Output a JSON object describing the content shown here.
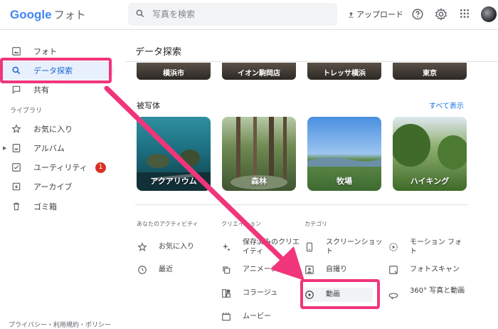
{
  "header": {
    "logo_google": "Google",
    "logo_product": "フォト",
    "search_placeholder": "写真を検索",
    "upload_label": "アップロード"
  },
  "sidebar": {
    "items": [
      {
        "label": "フォト",
        "icon": "photo-icon"
      },
      {
        "label": "データ探索",
        "icon": "search-icon",
        "active": true
      },
      {
        "label": "共有",
        "icon": "chat-icon"
      }
    ],
    "library_label": "ライブラリ",
    "library_items": [
      {
        "label": "お気に入り",
        "icon": "star-icon"
      },
      {
        "label": "アルバム",
        "icon": "album-icon"
      },
      {
        "label": "ユーティリティ",
        "icon": "utility-icon",
        "badge": "1"
      },
      {
        "label": "アーカイブ",
        "icon": "archive-icon"
      },
      {
        "label": "ゴミ箱",
        "icon": "trash-icon"
      }
    ],
    "footer": "プライバシー・利用規約・ポリシー"
  },
  "main": {
    "title": "データ探索",
    "places": [
      "横浜市",
      "イオン駒岡店",
      "トレッサ横浜",
      "東京"
    ],
    "subjects_title": "被写体",
    "see_all": "すべて表示",
    "subjects": [
      "アクアリウム",
      "森林",
      "牧場",
      "ハイキング"
    ],
    "activity_head": "あなたのアクティビティ",
    "activity": [
      "お気に入り",
      "最近"
    ],
    "creations_head": "クリエイション",
    "creations": [
      "保存済みのクリエイティ",
      "アニメーション",
      "コラージュ",
      "ムービー"
    ],
    "categories_head": "カテゴリ",
    "categories_col1": [
      "スクリーンショット",
      "自撮り",
      "動画"
    ],
    "categories_col2": [
      "モーション フォト",
      "フォトスキャン",
      "360° 写真と動画"
    ]
  },
  "colors": {
    "accent": "#f0357a",
    "link": "#1a73e8",
    "active_bg": "#e8f0fe",
    "badge": "#d93025"
  }
}
